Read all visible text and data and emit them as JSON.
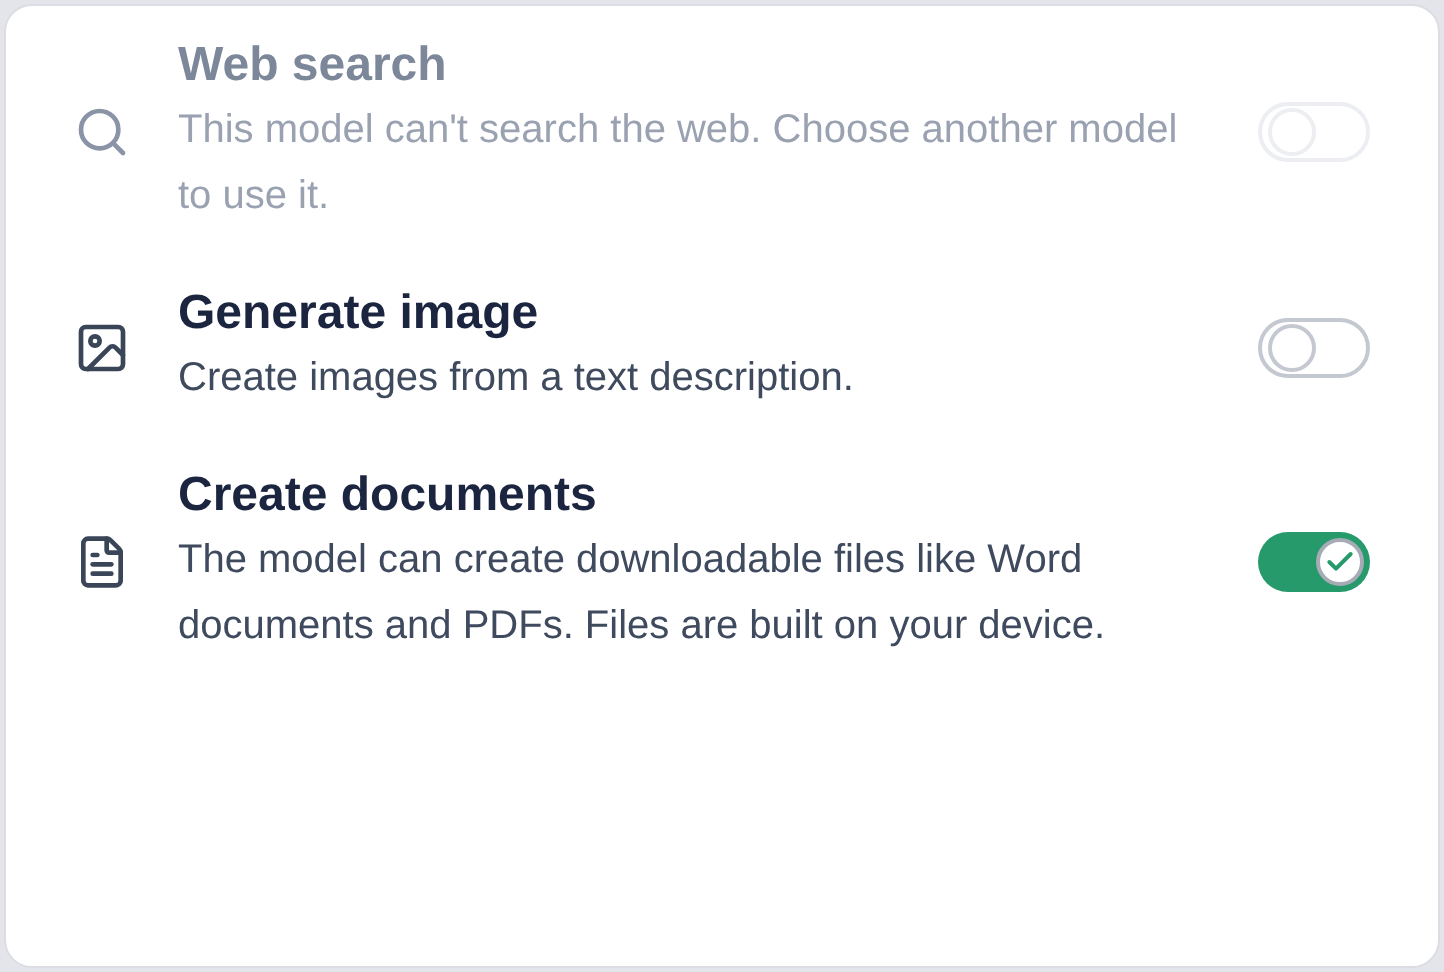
{
  "tools": [
    {
      "kind": "search",
      "title": "Web search",
      "description": "This model can't search the web. Choose another model to use it.",
      "disabled": true,
      "on": false
    },
    {
      "kind": "image",
      "title": "Generate image",
      "description": "Create images from a text description.",
      "disabled": false,
      "on": false
    },
    {
      "kind": "document",
      "title": "Create documents",
      "description": "The model can create downloadable files like Word documents and PDFs. Files are built on your device.",
      "disabled": false,
      "on": true
    }
  ]
}
